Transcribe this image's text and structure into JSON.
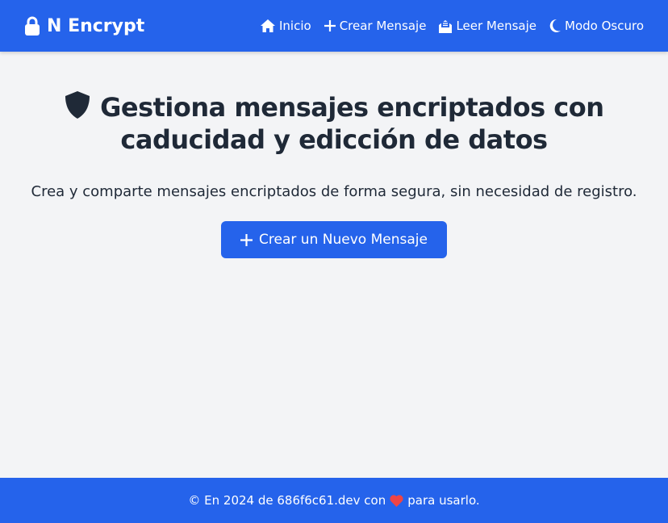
{
  "nav": {
    "brand": "N Encrypt",
    "links": [
      {
        "label": "Inicio",
        "icon": "home-icon"
      },
      {
        "label": "Crear Mensaje",
        "icon": "plus-icon"
      },
      {
        "label": "Leer Mensaje",
        "icon": "envelope-open-icon"
      },
      {
        "label": "Modo Oscuro",
        "icon": "moon-icon"
      }
    ]
  },
  "hero": {
    "title": "Gestiona mensajes encriptados con caducidad y edicción de datos",
    "subtitle": "Crea y comparte mensajes encriptados de forma segura, sin necesidad de registro.",
    "cta": "Crear un Nuevo Mensaje"
  },
  "footer": {
    "before": "© En 2024 de 686f6c61.dev con",
    "after": "para usarlo."
  },
  "colors": {
    "primary": "#2563eb",
    "background": "#f3f4f6",
    "heart": "#ef4444"
  }
}
